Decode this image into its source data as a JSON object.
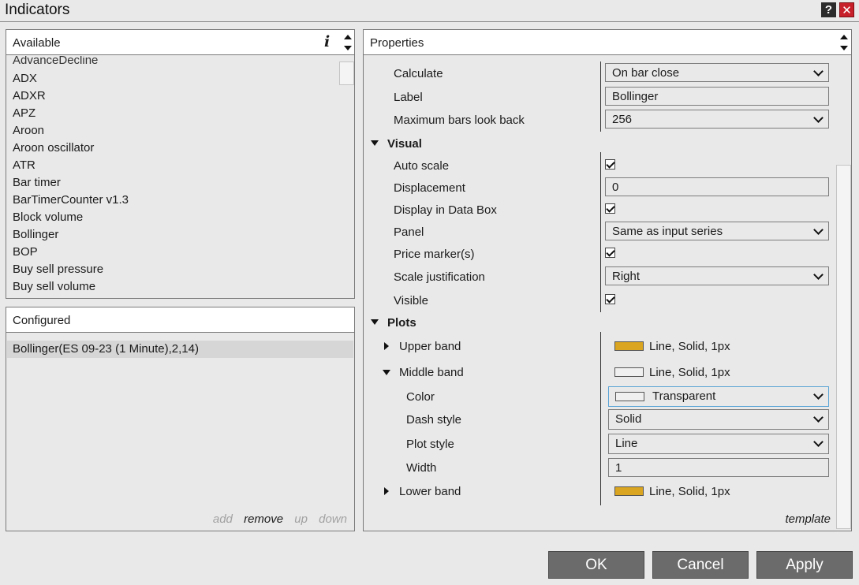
{
  "window": {
    "title": "Indicators",
    "help_label": "?",
    "close_label": "✕"
  },
  "available": {
    "header": "Available",
    "info_icon_glyph": "i",
    "partial_item": "AdvanceDecline",
    "items": [
      "ADX",
      "ADXR",
      "APZ",
      "Aroon",
      "Aroon oscillator",
      "ATR",
      "Bar timer",
      "BarTimerCounter v1.3",
      "Block volume",
      "Bollinger",
      "BOP",
      "Buy sell pressure",
      "Buy sell volume"
    ]
  },
  "configured": {
    "header": "Configured",
    "items": [
      "Bollinger(ES 09-23 (1 Minute),2,14)"
    ],
    "actions": {
      "add": "add",
      "remove": "remove",
      "up": "up",
      "down": "down"
    }
  },
  "properties": {
    "header": "Properties",
    "general": [
      {
        "label": "Calculate",
        "value": "On bar close",
        "type": "select"
      },
      {
        "label": "Label",
        "value": "Bollinger",
        "type": "text"
      },
      {
        "label": "Maximum bars look back",
        "value": "256",
        "type": "select"
      }
    ],
    "visual": {
      "title": "Visual",
      "rows": [
        {
          "label": "Auto scale",
          "type": "checkbox",
          "checked": true
        },
        {
          "label": "Displacement",
          "type": "text",
          "value": "0"
        },
        {
          "label": "Display in Data Box",
          "type": "checkbox",
          "checked": true
        },
        {
          "label": "Panel",
          "type": "select",
          "value": "Same as input series"
        },
        {
          "label": "Price marker(s)",
          "type": "checkbox",
          "checked": true
        },
        {
          "label": "Scale justification",
          "type": "select",
          "value": "Right"
        },
        {
          "label": "Visible",
          "type": "checkbox",
          "checked": true
        }
      ]
    },
    "plots": {
      "title": "Plots",
      "upper_band": {
        "label": "Upper band",
        "summary": "Line, Solid, 1px",
        "color": "#daa520"
      },
      "middle_band": {
        "label": "Middle band",
        "summary": "Line, Solid, 1px",
        "color": "#f0f0f0",
        "color_label": "Color",
        "color_value": "Transparent",
        "dash_label": "Dash style",
        "dash_value": "Solid",
        "plot_style_label": "Plot style",
        "plot_style_value": "Line",
        "width_label": "Width",
        "width_value": "1"
      },
      "lower_band": {
        "label": "Lower band",
        "summary": "Line, Solid, 1px",
        "color": "#daa520"
      }
    },
    "template_link": "template"
  },
  "buttons": {
    "ok": "OK",
    "cancel": "Cancel",
    "apply": "Apply"
  }
}
